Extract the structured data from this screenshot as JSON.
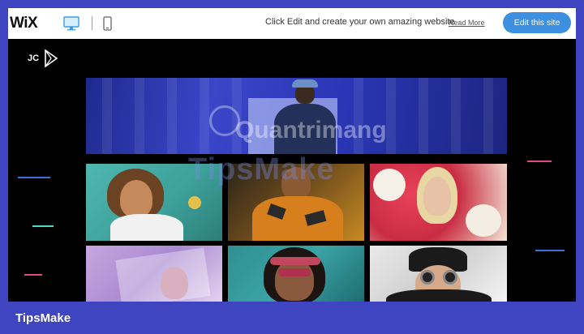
{
  "topbar": {
    "logo": "WiX",
    "desktop_icon": "desktop-monitor-icon",
    "mobile_icon": "mobile-phone-icon",
    "tagline": "Click Edit and create your own amazing website",
    "read_more": "Read More",
    "edit_button": "Edit this site"
  },
  "site": {
    "logo_text": "JC",
    "logo_icon": "play-triangle-icon",
    "hero_alt": "Man in cap against blue wall",
    "gallery": [
      {
        "alt": "Woman with curly hair on teal background"
      },
      {
        "alt": "Man in orange patterned shirt"
      },
      {
        "alt": "Woman surrounded by red and white flowers"
      },
      {
        "alt": "Woman behind purple plastic sheet"
      },
      {
        "alt": "Woman with sunglasses and visor"
      },
      {
        "alt": "Man with round sunglasses and beanie"
      }
    ]
  },
  "watermarks": {
    "quantrimang": "Quantrimang",
    "tipsmake_overlay": "TipsMake"
  },
  "footer": {
    "brand": "TipsMake"
  },
  "colors": {
    "frame_background": "#3f44c0",
    "edit_button": "#3d8fe0",
    "site_background": "#000000"
  }
}
